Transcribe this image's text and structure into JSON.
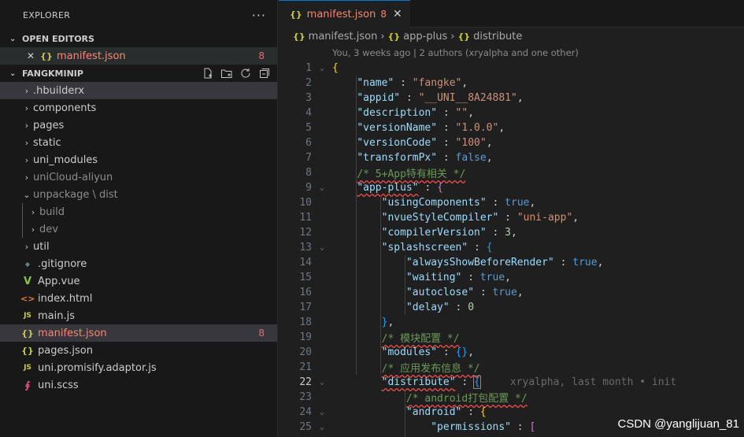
{
  "sidebar": {
    "title": "EXPLORER",
    "more": "···",
    "open_editors": {
      "label": "OPEN EDITORS",
      "items": [
        {
          "close": "✕",
          "icon": "{}",
          "name": "manifest.json",
          "badge": "8"
        }
      ]
    },
    "project": {
      "label": "FANGKMINIP",
      "items": [
        {
          "chev": "›",
          "icon": "",
          "name": ".hbuilderx",
          "badge": ""
        },
        {
          "chev": "›",
          "icon": "",
          "name": "components",
          "badge": ""
        },
        {
          "chev": "›",
          "icon": "",
          "name": "pages",
          "badge": ""
        },
        {
          "chev": "›",
          "icon": "",
          "name": "static",
          "badge": ""
        },
        {
          "chev": "›",
          "icon": "",
          "name": "uni_modules",
          "badge": ""
        },
        {
          "chev": "›",
          "icon": "",
          "name": "uniCloud-aliyun",
          "badge": ""
        },
        {
          "chev": "⌄",
          "icon": "",
          "name": "unpackage \\ dist",
          "badge": ""
        },
        {
          "chev": "›",
          "icon": "",
          "name": "build",
          "badge": ""
        },
        {
          "chev": "›",
          "icon": "",
          "name": "dev",
          "badge": ""
        },
        {
          "chev": "›",
          "icon": "",
          "name": "util",
          "badge": ""
        },
        {
          "chev": "",
          "icon": "◆",
          "name": ".gitignore",
          "badge": ""
        },
        {
          "chev": "",
          "icon": "V",
          "name": "App.vue",
          "badge": ""
        },
        {
          "chev": "",
          "icon": "<>",
          "name": "index.html",
          "badge": ""
        },
        {
          "chev": "",
          "icon": "JS",
          "name": "main.js",
          "badge": ""
        },
        {
          "chev": "",
          "icon": "{}",
          "name": "manifest.json",
          "badge": "8"
        },
        {
          "chev": "",
          "icon": "{}",
          "name": "pages.json",
          "badge": ""
        },
        {
          "chev": "",
          "icon": "JS",
          "name": "uni.promisify.adaptor.js",
          "badge": ""
        },
        {
          "chev": "",
          "icon": "∮",
          "name": "uni.scss",
          "badge": ""
        }
      ]
    }
  },
  "tab": {
    "icon": "{}",
    "name": "manifest.json",
    "badge": "8",
    "close": "✕"
  },
  "breadcrumb": {
    "icon": "{}",
    "parts": [
      "manifest.json",
      "app-plus",
      "distribute"
    ],
    "sep": "›"
  },
  "blame": "You, 3 weeks ago | 2 authors (xryalpha and one other)",
  "ghost_blame": "xryalpha, last month • init",
  "watermark": "CSDN @yanglijuan_81",
  "colors": {
    "accent": "#0078d4",
    "error": "#f48771",
    "key": "#9cdcfe",
    "string": "#ce9178",
    "keyword": "#569cd6",
    "comment": "#6a9955"
  }
}
